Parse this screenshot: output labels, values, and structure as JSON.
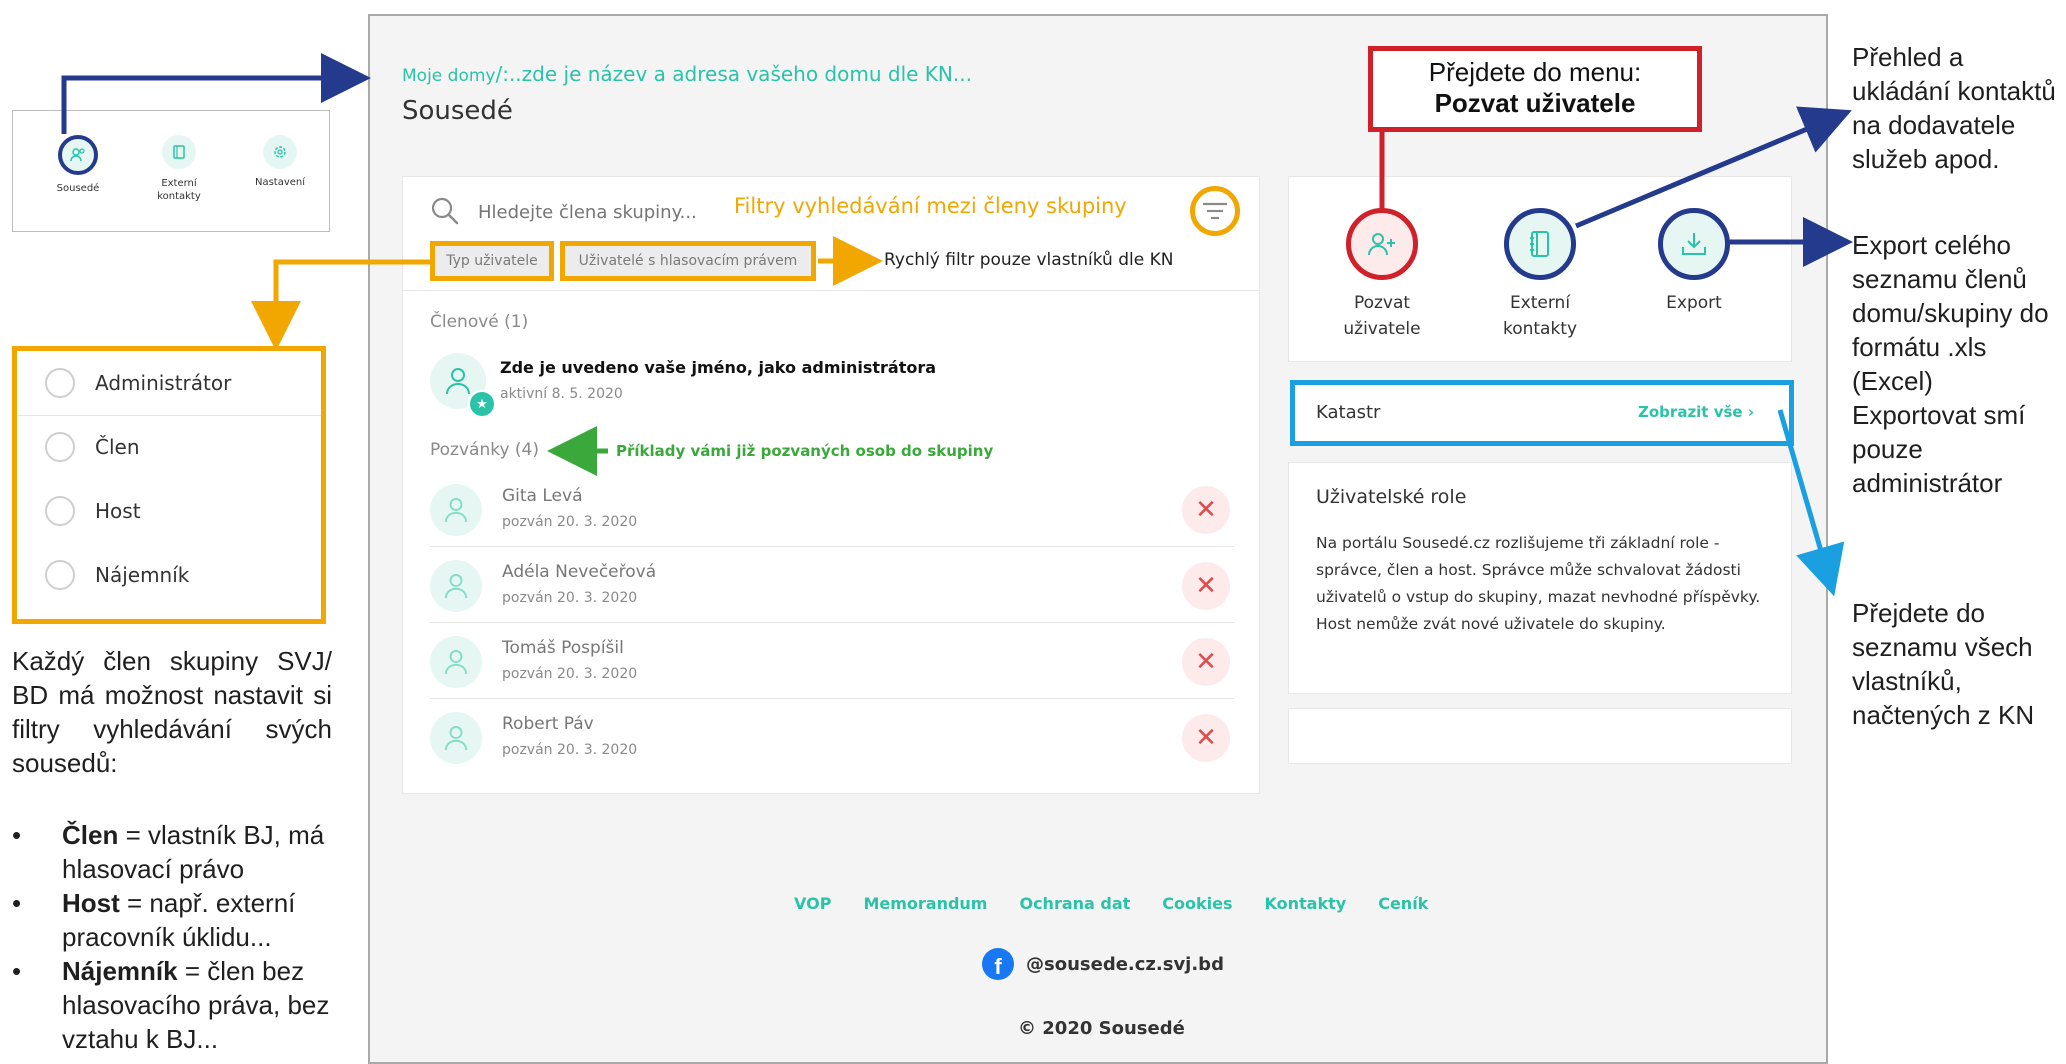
{
  "mini_nav": {
    "items": [
      {
        "label": "Sousedé"
      },
      {
        "label": "Externí\nkontakty"
      },
      {
        "label": "Nastavení"
      }
    ]
  },
  "header": {
    "breadcrumb_prefix": "Moje domy",
    "breadcrumb_rest": "/:..zde je název a adresa vašeho domu dle KN...",
    "title": "Sousedé"
  },
  "search": {
    "placeholder": "Hledejte člena skupiny..."
  },
  "filters": {
    "annotation": "Filtry vyhledávání mezi členy skupiny",
    "pill_type": "Typ uživatele",
    "pill_voting": "Uživatelé s hlasovacím právem",
    "quick_note": "Rychlý filtr pouze vlastníků dle KN"
  },
  "members": {
    "heading": "Členové (1)",
    "admin_name": "Zde je uvedeno vaše jméno, jako administrátora",
    "admin_status": "aktivní 8. 5. 2020"
  },
  "invites": {
    "heading": "Pozvánky (4)",
    "annotation": "Příklady vámi již pozvaných osob do skupiny",
    "items": [
      {
        "name": "Gita Levá",
        "status": "pozván 20. 3. 2020"
      },
      {
        "name": "Adéla Nevečeřová",
        "status": "pozván 20. 3. 2020"
      },
      {
        "name": "Tomáš Pospíšil",
        "status": "pozván 20. 3. 2020"
      },
      {
        "name": "Robert Páv",
        "status": "pozván 20. 3. 2020"
      }
    ]
  },
  "actions": {
    "invite_label": "Pozvat\nuživatele",
    "external_label": "Externí\nkontakty",
    "export_label": "Export"
  },
  "menu_callout": {
    "line1": "Přejdete do menu:",
    "line2": "Pozvat uživatele"
  },
  "katastr": {
    "title": "Katastr",
    "link": "Zobrazit vše"
  },
  "roles_card": {
    "title": "Uživatelské role",
    "text": "Na portálu Sousedé.cz rozlišujeme tři základní role - správce, člen a host. Správce může schvalovat žádosti uživatelů o vstup do skupiny, mazat nevhodné příspěvky. Host nemůže zvát nové uživatele do skupiny."
  },
  "roles_list": {
    "items": [
      "Administrátor",
      "Člen",
      "Host",
      "Nájemník"
    ]
  },
  "footer": {
    "links": [
      "VOP",
      "Memorandum",
      "Ochrana dat",
      "Cookies",
      "Kontakty",
      "Ceník"
    ],
    "facebook": "@sousede.cz.svj.bd",
    "copyright": "© 2020 Sousedé"
  },
  "side_notes": {
    "left_intro": "Každý člen skupiny SVJ/ BD má možnost nastavit si filtry vyhledávání svých sousedů:",
    "bullets": [
      {
        "bold": "Člen",
        "text": " = vlastník BJ, má hlasovací právo"
      },
      {
        "bold": "Host",
        "text": " = např. externí pracovník úklidu..."
      },
      {
        "bold": "Nájemník",
        "text": " = člen bez hlasovacího práva, bez vztahu k BJ..."
      }
    ],
    "right_contacts": "Přehled a ukládání kontaktů na dodavatele služeb apod.",
    "right_export": "Export celého seznamu členů domu/skupiny do formátu .xls (Excel) Exportovat smí pouze administrátor",
    "right_katastr": "Přejdete do seznamu všech vlastníků, načtených z KN"
  },
  "colors": {
    "teal": "#2ac3a8",
    "annotation_orange": "#f1a600",
    "annotation_navy": "#243a8c",
    "annotation_red": "#d0202a",
    "annotation_blue": "#1aa0e0",
    "annotation_green": "#3aa83a"
  }
}
